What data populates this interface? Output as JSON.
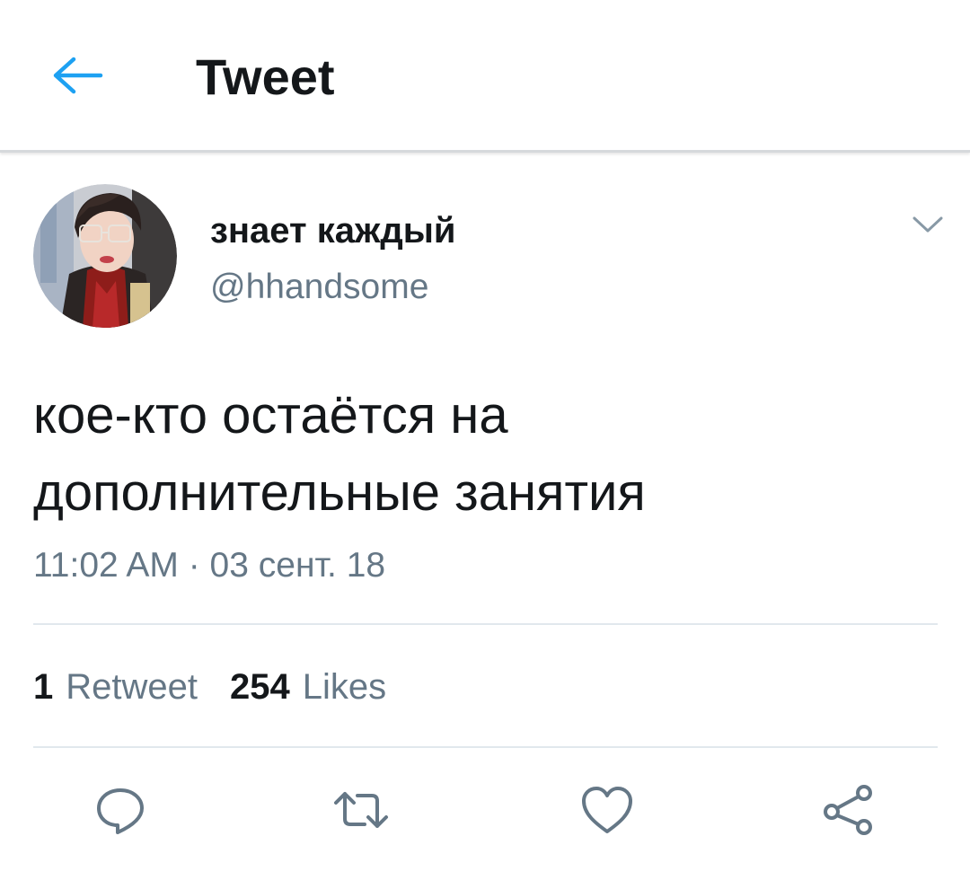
{
  "header": {
    "title": "Tweet",
    "back_icon": "arrow-left-icon"
  },
  "tweet": {
    "author": {
      "display_name": "знает каждый",
      "handle": "@hhandsome",
      "avatar": "avatar-photo"
    },
    "menu_icon": "chevron-down-icon",
    "text_line_1": "кое-кто остаётся на",
    "text_line_2": "дополнительные занятия",
    "timestamp": "11:02 AM · 03 сент. 18",
    "stats": {
      "retweets_count": "1",
      "retweets_label": "Retweet",
      "likes_count": "254",
      "likes_label": "Likes"
    }
  },
  "actions": [
    {
      "name": "reply",
      "icon": "speech-bubble-icon"
    },
    {
      "name": "retweet",
      "icon": "retweet-arrows-icon"
    },
    {
      "name": "like",
      "icon": "heart-icon"
    },
    {
      "name": "share",
      "icon": "share-nodes-icon"
    }
  ],
  "colors": {
    "accent": "#1da1f2",
    "text_primary": "#14171a",
    "text_secondary": "#657786",
    "divider": "#e1e8ed"
  }
}
